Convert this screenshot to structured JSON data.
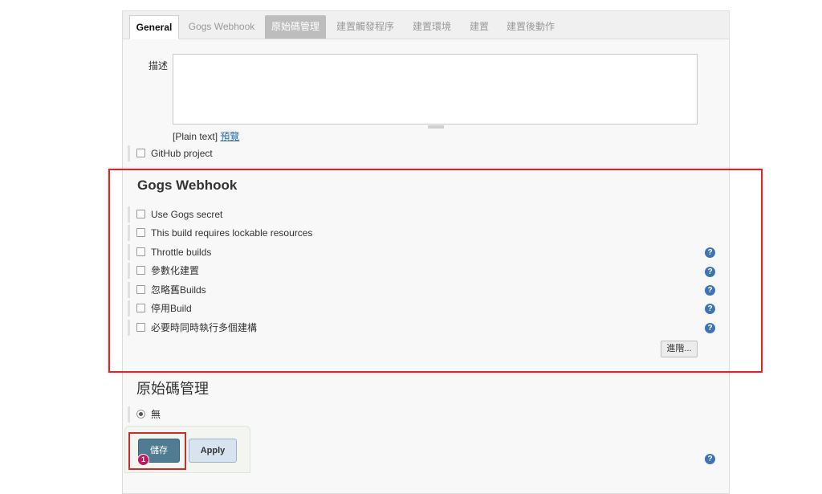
{
  "tabs": [
    {
      "label": "General"
    },
    {
      "label": "Gogs Webhook"
    },
    {
      "label": "原始碼管理"
    },
    {
      "label": "建置觸發程序"
    },
    {
      "label": "建置環境"
    },
    {
      "label": "建置"
    },
    {
      "label": "建置後動作"
    }
  ],
  "general": {
    "description_label": "描述",
    "description_value": "",
    "plain_text": "[Plain text]",
    "preview_link": "預覽",
    "github_project": "GitHub project"
  },
  "gogs": {
    "title": "Gogs Webhook",
    "options": [
      {
        "label": "Use Gogs secret"
      },
      {
        "label": "This build requires lockable resources"
      },
      {
        "label": "Throttle builds"
      },
      {
        "label": "參數化建置"
      },
      {
        "label": "忽略舊Builds"
      },
      {
        "label": "停用Build"
      },
      {
        "label": "必要時同時執行多個建構"
      }
    ],
    "advanced_button": "進階...",
    "help_glyph": "?"
  },
  "scm": {
    "title": "原始碼管理",
    "radio_none": "無"
  },
  "footer": {
    "save_label": "儲存",
    "apply_label": "Apply",
    "badge": "1"
  }
}
